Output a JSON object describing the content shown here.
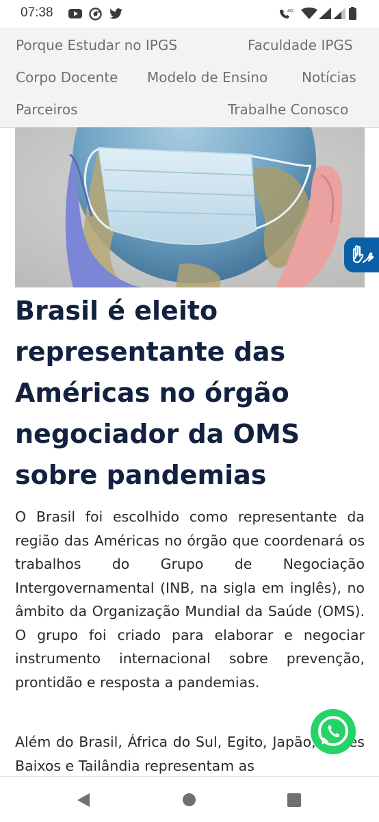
{
  "status_bar": {
    "time": "07:38",
    "network": "4G",
    "icons": [
      "youtube-icon",
      "chrome-icon",
      "twitter-icon",
      "wifi-calling-icon",
      "wifi-icon",
      "signal-icon",
      "signal-icon",
      "battery-icon"
    ]
  },
  "nav": {
    "items": [
      "Porque Estudar no IPGS",
      "Faculdade IPGS",
      "Corpo Docente",
      "Modelo de Ensino",
      "Notícias",
      "Parceiros",
      "Trabalhe Conosco"
    ]
  },
  "article": {
    "title_lines": [
      "Brasil é eleito",
      "representante das",
      "Américas no órgão",
      "negociador da OMS",
      "sobre pandemias"
    ],
    "paragraph1": "O Brasil foi escolhido como representante da região das Américas no órgão que coordenará os trabalhos do Grupo de Negociação Intergovernamental (INB, na sigla em inglês), no âmbito da Organização Mundial da Saúde (OMS). O grupo foi criado para elaborar e negociar instrumento internacional sobre prevenção, prontidão e resposta a pandemias.",
    "paragraph2": "Além do Brasil, África do Sul, Egito, Japão, Países Baixos e Tailândia representam as"
  },
  "widgets": {
    "accessibility_icon": "sign-language-hands-icon",
    "whatsapp_icon": "whatsapp-icon"
  },
  "colors": {
    "title": "#12213f",
    "accessibility": "#0b5fa6",
    "whatsapp": "#25d366",
    "nav_bg": "#f3f3f3"
  }
}
